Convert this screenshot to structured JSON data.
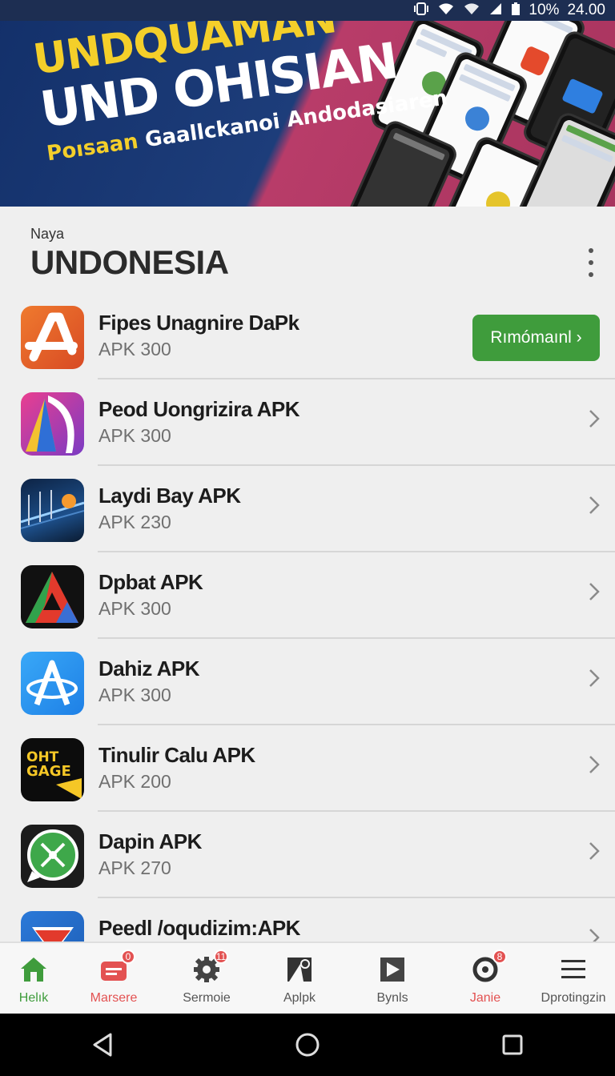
{
  "status_bar": {
    "battery": "10%",
    "time": "24.00"
  },
  "banner": {
    "line1": "UNDQUAMAN",
    "line2": "UND OHISIAN",
    "line3_highlight": "Poısaan",
    "line3_rest": "Gaallckanoi Andodasiaren"
  },
  "header": {
    "subtitle": "Naya",
    "title": "UNDONESIA"
  },
  "apps": [
    {
      "name": "Fipes Unagnire DaPk",
      "size": "APK 300",
      "icon": "a-logo-orange-icon",
      "action": "Rımómaınl ›"
    },
    {
      "name": "Peod Uongrizira APK",
      "size": "APK 300",
      "icon": "triangle-purple-icon"
    },
    {
      "name": "Laydi Bay APK",
      "size": "APK 230",
      "icon": "bridge-photo-icon"
    },
    {
      "name": "Dpbat APK",
      "size": "APK 300",
      "icon": "delta-red-green-icon"
    },
    {
      "name": "Dahiz APK",
      "size": "APK 300",
      "icon": "atom-a-blue-icon"
    },
    {
      "name": "Tinulir Calu APK",
      "size": "APK 200",
      "icon": "oht-gage-icon",
      "icon_text_1": "OHT",
      "icon_text_2": "GAGE"
    },
    {
      "name": "Dapin APK",
      "size": "APK 270",
      "icon": "whatsapp-compass-icon"
    },
    {
      "name": "Peedl /oqudizim:APK",
      "size": "",
      "icon": "flag-blue-red-icon"
    }
  ],
  "bottom_nav": [
    {
      "label": "Helık",
      "icon": "home-icon",
      "active": true
    },
    {
      "label": "Marsere",
      "icon": "inbox-icon",
      "badge": "0"
    },
    {
      "label": "Sermoie",
      "icon": "gear-icon",
      "badge": "11"
    },
    {
      "label": "Aplpk",
      "icon": "apk-icon"
    },
    {
      "label": "Bynls",
      "icon": "play-icon"
    },
    {
      "label": "Janie",
      "icon": "refresh-icon",
      "badge": "8"
    },
    {
      "label": "Dprotingzin",
      "icon": "menu-icon"
    }
  ],
  "colors": {
    "accent_green": "#3f9c3c",
    "accent_red": "#e35252",
    "banner_yellow": "#f4cf2a",
    "banner_blue": "#13306a",
    "banner_pink": "#b83c69"
  }
}
